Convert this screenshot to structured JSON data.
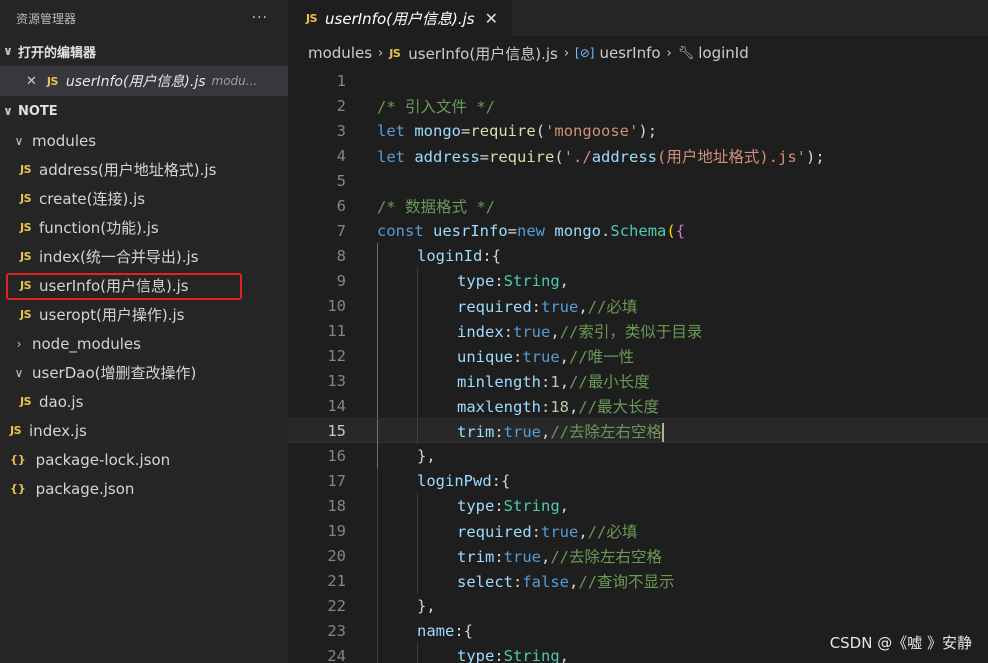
{
  "sidebar": {
    "title": "资源管理器",
    "more": "···",
    "open_editors": {
      "label": "打开的编辑器",
      "item": {
        "badge": "JS",
        "name": "userInfo(用户信息).js",
        "path": "modu..."
      }
    },
    "project": {
      "label": "NOTE",
      "tree": [
        {
          "type": "folder",
          "expanded": true,
          "name": "modules",
          "depth": 1
        },
        {
          "type": "js",
          "name": "address(用户地址格式).js",
          "depth": 2
        },
        {
          "type": "js",
          "name": "create(连接).js",
          "depth": 2
        },
        {
          "type": "js",
          "name": "function(功能).js",
          "depth": 2
        },
        {
          "type": "js",
          "name": "index(统一合并导出).js",
          "depth": 2
        },
        {
          "type": "js",
          "name": "userInfo(用户信息).js",
          "depth": 2,
          "selected": true
        },
        {
          "type": "js",
          "name": "useropt(用户操作).js",
          "depth": 2
        },
        {
          "type": "folder",
          "expanded": false,
          "name": "node_modules",
          "depth": 1
        },
        {
          "type": "folder",
          "expanded": true,
          "name": "userDao(增删查改操作)",
          "depth": 1
        },
        {
          "type": "js",
          "name": "dao.js",
          "depth": 2
        },
        {
          "type": "js",
          "name": "index.js",
          "depth": 1
        },
        {
          "type": "json",
          "name": "package-lock.json",
          "depth": 1
        },
        {
          "type": "json",
          "name": "package.json",
          "depth": 1
        }
      ]
    }
  },
  "editor": {
    "tab": {
      "badge": "JS",
      "name": "userInfo(用户信息).js",
      "close": "✕"
    },
    "breadcrumb": {
      "folder": "modules",
      "file": "userInfo(用户信息).js",
      "symbol": "uesrInfo",
      "property": "loginId",
      "sep": "›"
    },
    "active_line": 15,
    "lines": [
      {
        "n": "1",
        "text": ""
      },
      {
        "n": "2",
        "text": "/* 引入文件 */"
      },
      {
        "n": "3",
        "text": "let mongo=require('mongoose');"
      },
      {
        "n": "4",
        "text": "let address=require('./address(用户地址格式).js');"
      },
      {
        "n": "5",
        "text": ""
      },
      {
        "n": "6",
        "text": "/* 数据格式 */"
      },
      {
        "n": "7",
        "text": "const uesrInfo=new mongo.Schema({"
      },
      {
        "n": "8",
        "text": "loginId:{"
      },
      {
        "n": "9",
        "text": "type:String,"
      },
      {
        "n": "10",
        "text": "required:true,//必填"
      },
      {
        "n": "11",
        "text": "index:true,//索引，类似于目录"
      },
      {
        "n": "12",
        "text": "unique:true,//唯一性"
      },
      {
        "n": "13",
        "text": "minlength:1,//最小长度"
      },
      {
        "n": "14",
        "text": "maxlength:18,//最大长度"
      },
      {
        "n": "15",
        "text": "trim:true,//去除左右空格"
      },
      {
        "n": "16",
        "text": "},"
      },
      {
        "n": "17",
        "text": "loginPwd:{"
      },
      {
        "n": "18",
        "text": "type:String,"
      },
      {
        "n": "19",
        "text": "required:true,//必填"
      },
      {
        "n": "20",
        "text": "trim:true,//去除左右空格"
      },
      {
        "n": "21",
        "text": "select:false,//查询不显示"
      },
      {
        "n": "22",
        "text": "},"
      },
      {
        "n": "23",
        "text": "name:{"
      },
      {
        "n": "24",
        "text": "type:String,"
      }
    ]
  },
  "watermark": "CSDN @《嘘 》安静",
  "colors": {
    "sidebar_bg": "#252526",
    "editor_bg": "#1e1e1e",
    "selection_outline": "#e02424",
    "js_badge": "#e8c44c",
    "keyword": "#569cd6",
    "variable": "#9cdcfe",
    "function": "#dcdcaa",
    "string": "#ce9178",
    "comment": "#6a9955",
    "type": "#4ec9b0",
    "number": "#b5cea8"
  }
}
